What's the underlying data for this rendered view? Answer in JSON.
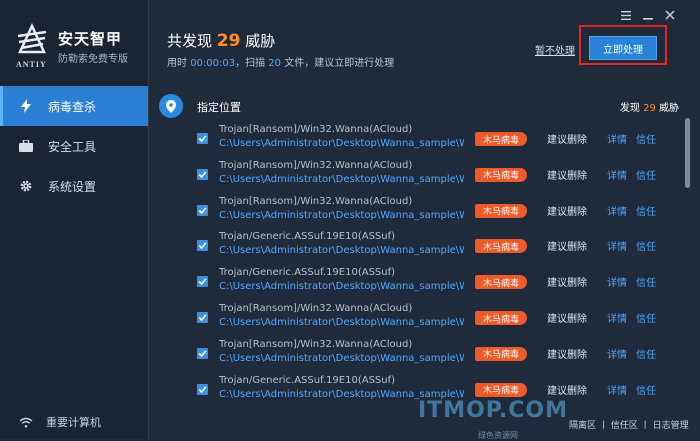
{
  "app": {
    "logo_text": "ANTIY",
    "title": "安天智甲",
    "tagline": "防勒索免费专版"
  },
  "window": {
    "menu_icon": "menu-icon",
    "minimize_icon": "minimize-icon",
    "close_icon": "close-icon"
  },
  "sidebar": {
    "items": [
      {
        "label": "病毒查杀",
        "icon": "lightning-icon",
        "active": true
      },
      {
        "label": "安全工具",
        "icon": "briefcase-icon",
        "active": false
      },
      {
        "label": "系统设置",
        "icon": "gear-icon",
        "active": false
      }
    ],
    "restart_label": "重要计算机"
  },
  "header": {
    "title_prefix": "共发现",
    "count": "29",
    "title_suffix": "威胁",
    "time_label": "用时",
    "time_value": "00:00:03",
    "scan_prefix": "，扫描",
    "scan_count": "20",
    "scan_suffix": "文件，建议立即进行处理",
    "skip_label": "暂不处理",
    "process_label": "立即处理"
  },
  "group": {
    "label": "指定位置",
    "count_prefix": "发现",
    "count": "29",
    "count_suffix": "威胁"
  },
  "rows": [
    {
      "name": "Trojan[Ransom]/Win32.Wanna(ACloud)",
      "path": "C:\\Users\\Administrator\\Desktop\\Wanna_sample\\Wa",
      "badge": "木马病毒",
      "action": "建议删除",
      "detail": "详情",
      "trust": "信任"
    },
    {
      "name": "Trojan[Ransom]/Win32.Wanna(ACloud)",
      "path": "C:\\Users\\Administrator\\Desktop\\Wanna_sample\\Wa",
      "badge": "木马病毒",
      "action": "建议删除",
      "detail": "详情",
      "trust": "信任"
    },
    {
      "name": "Trojan[Ransom]/Win32.Wanna(ACloud)",
      "path": "C:\\Users\\Administrator\\Desktop\\Wanna_sample\\Wa",
      "badge": "木马病毒",
      "action": "建议删除",
      "detail": "详情",
      "trust": "信任"
    },
    {
      "name": "Trojan/Generic.ASSuf.19E10(ASSuf)",
      "path": "C:\\Users\\Administrator\\Desktop\\Wanna_sample\\Wa",
      "badge": "木马病毒",
      "action": "建议删除",
      "detail": "详情",
      "trust": "信任"
    },
    {
      "name": "Trojan/Generic.ASSuf.19E10(ASSuf)",
      "path": "C:\\Users\\Administrator\\Desktop\\Wanna_sample\\Wa",
      "badge": "木马病毒",
      "action": "建议删除",
      "detail": "详情",
      "trust": "信任"
    },
    {
      "name": "Trojan[Ransom]/Win32.Wanna(ACloud)",
      "path": "C:\\Users\\Administrator\\Desktop\\Wanna_sample\\Wa",
      "badge": "木马病毒",
      "action": "建议删除",
      "detail": "详情",
      "trust": "信任"
    },
    {
      "name": "Trojan[Ransom]/Win32.Wanna(ACloud)",
      "path": "C:\\Users\\Administrator\\Desktop\\Wanna_sample\\Wa",
      "badge": "木马病毒",
      "action": "建议删除",
      "detail": "详情",
      "trust": "信任"
    },
    {
      "name": "Trojan/Generic.ASSuf.19E10(ASSuf)",
      "path": "C:\\Users\\Administrator\\Desktop\\Wanna_sample\\Wa",
      "badge": "木马病毒",
      "action": "建议删除",
      "detail": "详情",
      "trust": "信任"
    }
  ],
  "footer": {
    "quarantine": "隔离区",
    "trust_zone": "信任区",
    "log": "日志管理",
    "sep": "丨"
  },
  "watermark": {
    "text": "ITMOP.COM",
    "sub": "绿色资源网"
  },
  "colors": {
    "accent": "#2a82d6",
    "threat": "#ff8c2b",
    "badge": "#ee5a2a",
    "link": "#4ea6ff"
  }
}
